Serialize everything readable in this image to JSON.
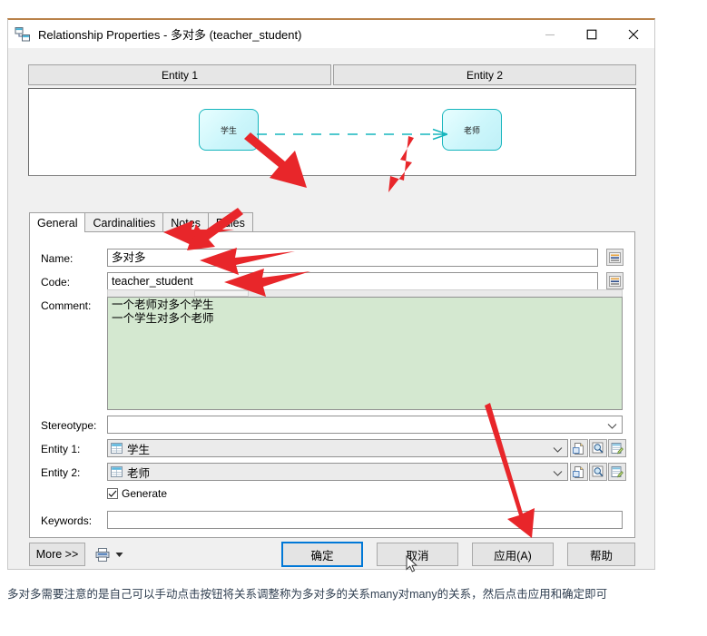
{
  "window": {
    "icon": "relationship-icon",
    "title": "Relationship Properties - 多对多 (teacher_student)",
    "controls": {
      "minimize": "—",
      "maximize": "□",
      "close": "✕"
    }
  },
  "preview": {
    "headers": [
      "Entity 1",
      "Entity 2"
    ],
    "entity1_label": "学生",
    "entity2_label": "老师",
    "link_style": "dashed-crowsfoot",
    "link_color": "#16b5bd"
  },
  "tabs": [
    {
      "label": "General",
      "active": true
    },
    {
      "label": "Cardinalities",
      "active": false
    },
    {
      "label": "Notes",
      "active": false
    },
    {
      "label": "Rules",
      "active": false
    }
  ],
  "form": {
    "name_label": "Name:",
    "name_value": "多对多",
    "code_label": "Code:",
    "code_value": "teacher_student",
    "comment_label": "Comment:",
    "comment_value": "一个老师对多个学生\n一个学生对多个老师",
    "stereotype_label": "Stereotype:",
    "stereotype_value": "",
    "entity1_label": "Entity 1:",
    "entity1_value": "学生",
    "entity2_label": "Entity 2:",
    "entity2_value": "老师",
    "generate_label": "Generate",
    "generate_checked": true,
    "keywords_label": "Keywords:",
    "keywords_value": "",
    "equalize_button": "=",
    "row_buttons": [
      "create-icon",
      "browse-icon",
      "properties-icon"
    ]
  },
  "footer": {
    "more_label": "More >>",
    "print_icon": "printer-icon",
    "print_dropdown": "▼",
    "ok_label": "确定",
    "cancel_label": "取消",
    "apply_label": "应用(A)",
    "help_label": "帮助"
  },
  "caption": {
    "text": "多对多需要注意的是自己可以手动点击按钮将关系调整称为多对多的关系many对many的关系，然后点击应用和确定即可"
  },
  "annotations": {
    "color": "#e8262a",
    "arrow_count": 5,
    "targets": [
      "entity1-box",
      "entity2-box",
      "rules-tab",
      "name-field",
      "code-field",
      "comment-field",
      "apply-button"
    ]
  }
}
